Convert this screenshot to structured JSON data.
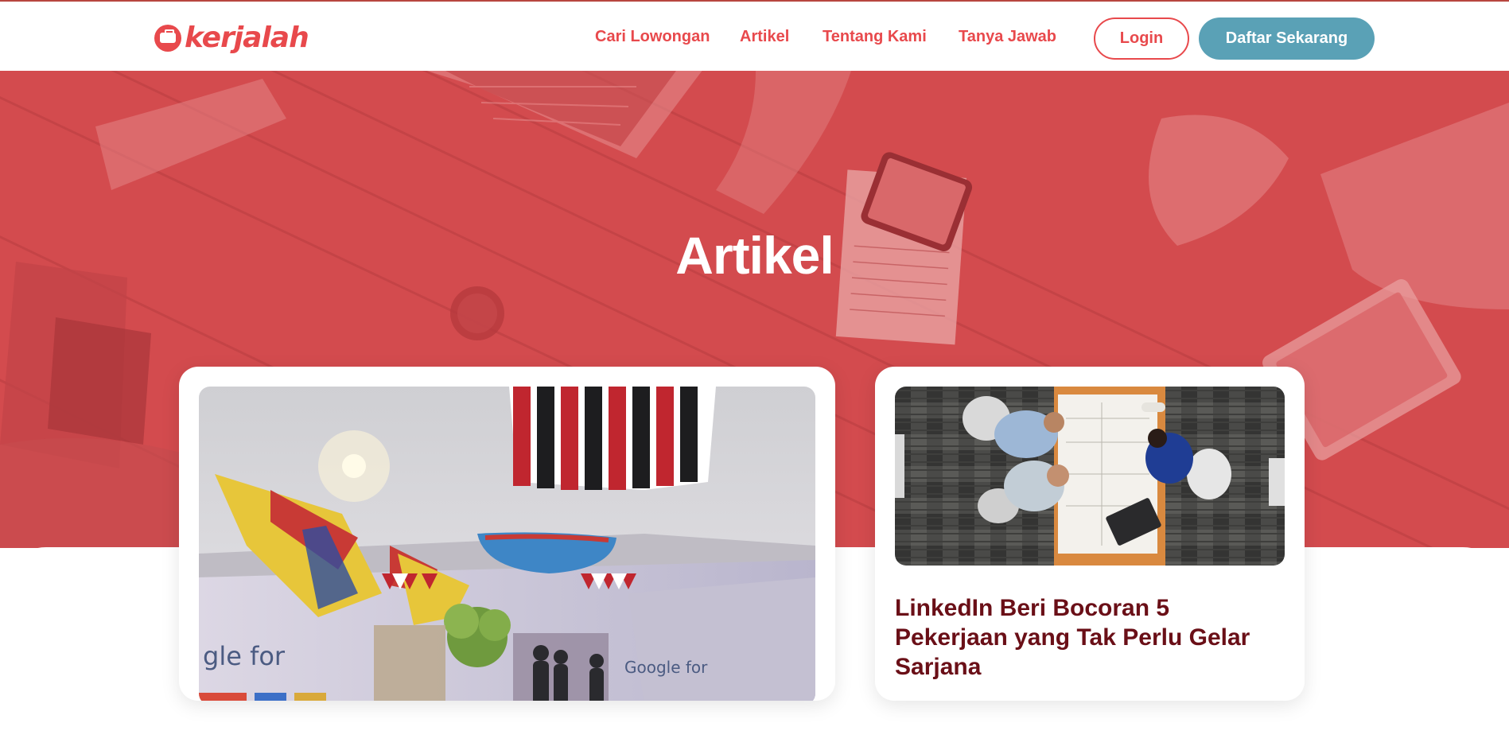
{
  "header": {
    "logo_text": "kerjalah",
    "logo_icon": "briefcase-icon",
    "nav": [
      {
        "label": "Cari Lowongan"
      },
      {
        "label": "Artikel"
      },
      {
        "label": "Tentang Kami"
      },
      {
        "label": "Tanya Jawab"
      }
    ],
    "login_label": "Login",
    "signup_label": "Daftar Sekarang"
  },
  "hero": {
    "title": "Artikel"
  },
  "articles": [
    {
      "image": "photo-google-for-indonesia-event",
      "title": ""
    },
    {
      "image": "photo-team-meeting-overhead",
      "title": "LinkedIn Beri Bocoran 5 Pekerjaan yang Tak Perlu Gelar Sarjana"
    }
  ],
  "colors": {
    "brand_red": "#e8494c",
    "hero_red": "#d34b4e",
    "signup_blue": "#5aa1b6",
    "article_title": "#6a0f17"
  }
}
